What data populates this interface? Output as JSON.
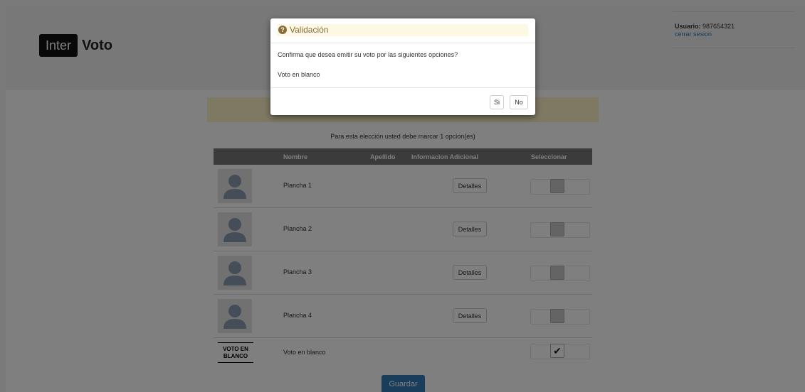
{
  "app": {
    "logo_inter": "Inter",
    "logo_voto": "Voto"
  },
  "user": {
    "label": "Usuario:",
    "id": "987654321",
    "logout": "cerrar sesion"
  },
  "instruction": "Para esta elección usted debe marcar 1 opcion(es)",
  "table": {
    "headers": {
      "nombre": "Nombre",
      "apellido": "Apellido",
      "info": "Informacion Adicional",
      "seleccionar": "Seleccionar"
    },
    "rows": [
      {
        "name": "Plancha 1",
        "details": "Detalles",
        "selected": false
      },
      {
        "name": "Plancha 2",
        "details": "Detalles",
        "selected": false
      },
      {
        "name": "Plancha 3",
        "details": "Detalles",
        "selected": false
      },
      {
        "name": "Plancha 4",
        "details": "Detalles",
        "selected": false
      }
    ],
    "blank": {
      "logo_line1": "VOTO EN",
      "logo_line2": "BLANCO",
      "name": "Voto en blanco",
      "selected": true,
      "check_glyph": "✔"
    }
  },
  "save_label": "Guardar",
  "modal": {
    "title": "Validación",
    "title_icon": "question-circle-icon",
    "message": "Confirma que desea emitir su voto por las siguientes opciones?",
    "choice": "Voto en blanco",
    "yes_label": "Si",
    "no_label": "No"
  },
  "colors": {
    "primary": "#337ab7",
    "warning_bg": "#fcf8e3",
    "warning_text": "#8a6d3b",
    "table_header": "#777777"
  }
}
